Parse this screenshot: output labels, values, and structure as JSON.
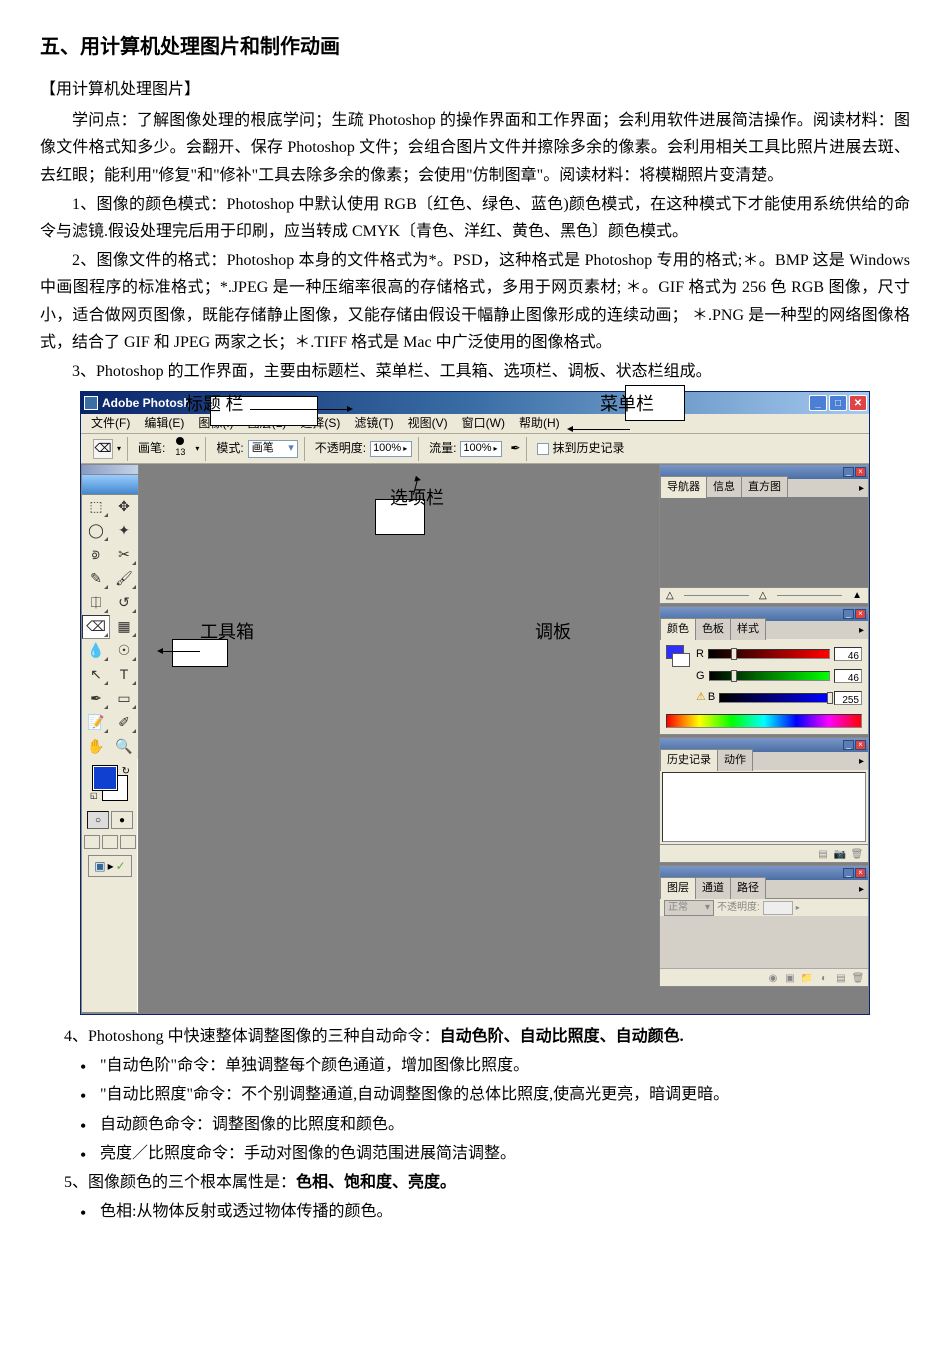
{
  "title": "五、用计算机处理图片和制作动画",
  "section1_head": "【用计算机处理图片】",
  "p1": "学问点：了解图像处理的根底学问；生疏 Photoshop 的操作界面和工作界面；会利用软件进展简洁操作。阅读材料：图像文件格式知多少。会翻开、保存 Photoshop 文件；会组合图片文件并擦除多余的像素。会利用相关工具比照片进展去斑、去红眼；能利用\"修复\"和\"修补\"工具去除多余的像素；会使用\"仿制图章\"。阅读材料：将模糊照片变清楚。",
  "p2": "1、图像的颜色模式：Photoshop 中默认使用 RGB〔红色、绿色、蓝色)颜色模式，在这种模式下才能使用系统供给的命令与滤镜.假设处理完后用于印刷，应当转成 CMYK〔青色、洋红、黄色、黑色〕颜色模式。",
  "p3": "2、图像文件的格式：Photoshop 本身的文件格式为*。PSD，这种格式是 Photoshop 专用的格式;＊。BMP 这是 Windows 中画图程序的标准格式；*.JPEG 是一种压缩率很高的存储格式，多用于网页素材; ＊。GIF 格式为 256 色 RGB 图像，尺寸小，适合做网页图像，既能存储静止图像，又能存储由假设干幅静止图像形成的连续动画； ＊.PNG 是一种型的网络图像格式，结合了 GIF 和 JPEG 两家之长；＊.TIFF 格式是 Mac 中广泛使用的图像格式。",
  "p4": "3、Photoshop 的工作界面，主要由标题栏、菜单栏、工具箱、选项栏、调板、状态栏组成。",
  "anno": {
    "titlebar": "标题 栏",
    "menubar": "菜单栏",
    "optionbar": "选项栏",
    "toolbox": "工具箱",
    "panels": "调板"
  },
  "ps": {
    "title": "Adobe Photosh",
    "menus": [
      "文件(F)",
      "编辑(E)",
      "图像(I)",
      "图层(L)",
      "选择(S)",
      "滤镜(T)",
      "视图(V)",
      "窗口(W)",
      "帮助(H)"
    ],
    "opt": {
      "brush_label": "画笔:",
      "brush_size": "13",
      "mode_label": "模式:",
      "mode_value": "画笔",
      "opacity_label": "不透明度:",
      "opacity_value": "100%",
      "flow_label": "流量:",
      "flow_value": "100%",
      "checkbox_label": "抹到历史记录"
    },
    "nav_tabs": [
      "导航器",
      "信息",
      "直方图"
    ],
    "color_tabs": [
      "颜色",
      "色板",
      "样式"
    ],
    "rgb": {
      "r": "46",
      "g": "46",
      "b": "255"
    },
    "history_tabs": [
      "历史记录",
      "动作"
    ],
    "layers_tabs": [
      "图层",
      "通道",
      "路径"
    ],
    "layers_mode": "正常",
    "layers_opacity_label": "不透明度:"
  },
  "p5_pre": "4、Photoshong 中快速整体调整图像的三种自动命令：",
  "p5_bold": "自动色阶、自动比照度、自动颜色.",
  "bul1": "\"自动色阶\"命令：单独调整每个颜色通道，增加图像比照度。",
  "bul2": "\"自动比照度\"命令：不个别调整通道,自动调整图像的总体比照度,使高光更亮，暗调更暗。",
  "bul3": "自动颜色命令：调整图像的比照度和颜色。",
  "bul4": "亮度／比照度命令：手动对图像的色调范围进展简洁调整。",
  "p6_pre": "5、图像颜色的三个根本属性是：",
  "p6_bold": "色相、饱和度、亮度。",
  "bul5": "色相:从物体反射或透过物体传播的颜色。"
}
